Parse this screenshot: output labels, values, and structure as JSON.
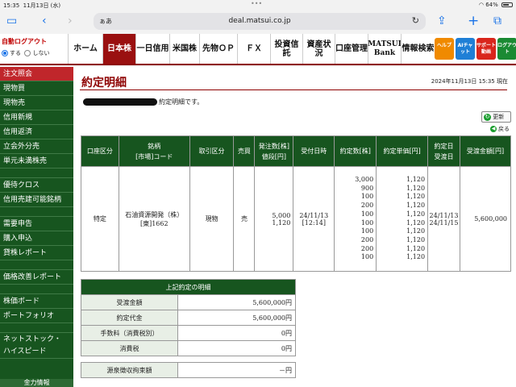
{
  "status": {
    "time": "15:35",
    "date": "11月13日 (水)",
    "dots": "•••",
    "battery": "64%"
  },
  "browser": {
    "aa": "ぁあ",
    "url": "deal.matsui.co.jp",
    "tabs_count_icon": "tabs-icon"
  },
  "auto_logout": {
    "title": "自動ログアウト",
    "option_on": "する",
    "option_off": "しない"
  },
  "nav": {
    "tabs": [
      "ホーム",
      "日本株",
      "一日信用",
      "米国株",
      "先物ＯＰ",
      "ＦＸ",
      "投資信託",
      "資産状況",
      "口座管理",
      "MATSUI Bank",
      "情報検索"
    ],
    "quick": [
      "ヘルプ",
      "AIチャット",
      "サポート動画",
      "ログアウト"
    ],
    "quick_colors": [
      "#f08a00",
      "#1f7fd6",
      "#d9261c",
      "#1a8a33"
    ]
  },
  "sidebar": {
    "items": [
      "注文照会",
      "現物買",
      "現物売",
      "信用新規",
      "信用返済",
      "立会外分売",
      "単元未満株売",
      "優待クロス",
      "信用売建可能銘柄",
      "需要申告",
      "購入申込",
      "貸株レポート",
      "価格改善レポート",
      "株価ボード",
      "ポートフォリオ",
      "ネットストック・",
      "ハイスピード",
      "金力情報"
    ]
  },
  "page": {
    "title": "約定明細",
    "datetime": "2024年11月13日 15:35 現在",
    "message_suffix": "約定明細です。",
    "update_label": "更新",
    "back_label": "戻る"
  },
  "order_table": {
    "headers": [
      "口座区分",
      "銘柄\n[市場]コード",
      "取引区分",
      "売買",
      "発注数[株]\n値段[円]",
      "受付日時",
      "約定数[株]",
      "約定単価[円]",
      "約定日\n受渡日",
      "受渡金額[円]"
    ],
    "row": {
      "account": "特定",
      "stock_name": "石油資源開発（株）",
      "stock_code": "[東]1662",
      "trade_type": "現物",
      "side": "売",
      "order_qty": "5,000",
      "order_price": "1,120",
      "received_date": "24/11/13",
      "received_time": "[12:14]",
      "exec_qty": [
        "3,000",
        "900",
        "100",
        "200",
        "100",
        "100",
        "100",
        "200",
        "200",
        "100"
      ],
      "exec_price": [
        "1,120",
        "1,120",
        "1,120",
        "1,120",
        "1,120",
        "1,120",
        "1,120",
        "1,120",
        "1,120",
        "1,120"
      ],
      "exec_date": "24/11/13",
      "settle_date": "24/11/15",
      "settle_amount": "5,600,000"
    }
  },
  "summary_table": {
    "title": "上記約定の明細",
    "rows": [
      {
        "label": "受渡金額",
        "value": "5,600,000円"
      },
      {
        "label": "約定代金",
        "value": "5,600,000円"
      },
      {
        "label": "手数料（消費税別）",
        "value": "0円"
      },
      {
        "label": "消費税",
        "value": "0円"
      },
      {
        "label": "源泉徴収拘束額",
        "value": "－円"
      }
    ]
  }
}
